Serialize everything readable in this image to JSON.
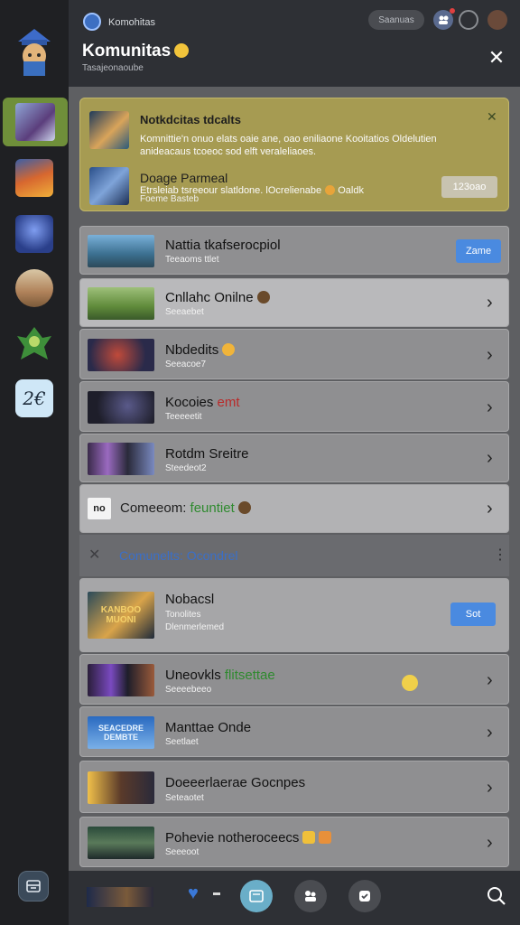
{
  "header": {
    "app_small": "Komohitas",
    "title": "Komunitas",
    "subtitle": "Tasajeonaoube",
    "pill_button": "Saanuas"
  },
  "notification": {
    "title": "Notkdcitas tdcalts",
    "body": "Komnittie'n onuo elats oaie ane, oao eniliaone Kooitatios Oldelutien anideacaus tcoeoc sod elft veraleliaoes.",
    "title2": "Doage Parmeal",
    "line2": "Etrsleiab tsreeour slatldone. lOcrelienabe",
    "line2_suffix": "Oaldk",
    "line3": "Foeme Basteb",
    "pill": "123oao"
  },
  "rows": [
    {
      "title": "Nattia tkafserocpiol",
      "sub": "Teeaoms ttlet",
      "button": "Zame",
      "has_button": true
    },
    {
      "title": "Cnllahc Onilne",
      "sub": "Seeaebet",
      "has_button": false
    },
    {
      "title": "Nbdedits",
      "sub": "Seeacoe7",
      "has_button": false
    },
    {
      "title": "Kocoies",
      "title_accent": "emt",
      "sub": "Teeeeetit",
      "has_button": false
    },
    {
      "title": "Rotdm Sreitre",
      "sub": "Steedeot2",
      "has_button": false
    },
    {
      "title": "Comeeom:",
      "title_accent": "feuntiet",
      "thumb_text": "no",
      "has_button": false
    }
  ],
  "section": {
    "label": "Comunelts: Ocondrel"
  },
  "featured": {
    "title": "Nobacsl",
    "sub1": "Tonolites",
    "sub2": "Dlenmerlemed",
    "button": "Sot",
    "thumb_text": "KANBOO MUONI"
  },
  "rows2": [
    {
      "title": "Uneovkls",
      "title_accent": "flitsettae",
      "sub": "Seeeebeeo"
    },
    {
      "title": "Manttae Onde",
      "sub": "Seetlaet",
      "thumb_text": "SEACEDRE DEMBTE"
    },
    {
      "title": "Doeeerlaerae Gocnpes",
      "sub": "Seteaotet"
    },
    {
      "title": "Pohevie notheroceecs",
      "sub": "Seeeoot"
    }
  ],
  "colors": {
    "accent_blue": "#4a8ae0",
    "notification_bg": "#a69b52",
    "active_rail": "#6f8f3a",
    "accent_green": "#2f8a2f"
  },
  "icons": {
    "close": "close-icon",
    "chevron": "chevron-right-icon",
    "search": "search-icon"
  }
}
